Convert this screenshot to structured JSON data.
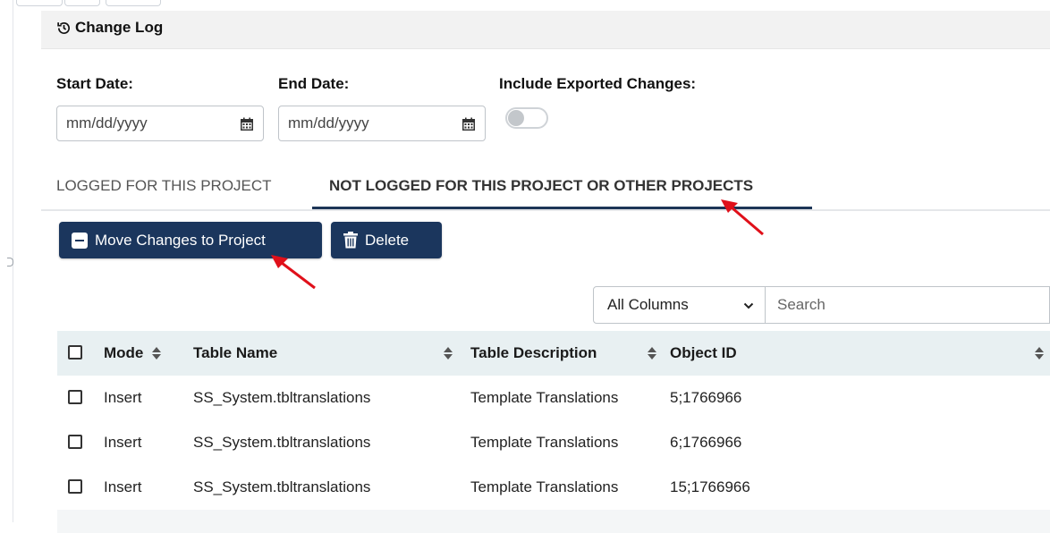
{
  "colors": {
    "primary": "#1b365d",
    "header_bg": "#e8f0f2",
    "annotation_arrow": "#e0101a"
  },
  "card": {
    "title": "Change Log",
    "icon": "history-icon"
  },
  "filters": {
    "start_label": "Start Date:",
    "end_label": "End Date:",
    "include_label": "Include Exported Changes:",
    "date_placeholder": "mm/dd/yyyy",
    "include_exported": false
  },
  "tabs": [
    {
      "label": "LOGGED FOR THIS PROJECT",
      "active": false
    },
    {
      "label": "NOT LOGGED FOR THIS PROJECT OR OTHER PROJECTS",
      "active": true
    }
  ],
  "actions": {
    "move_label": "Move Changes to Project",
    "delete_label": "Delete"
  },
  "search": {
    "column_select": "All Columns",
    "placeholder": "Search"
  },
  "table": {
    "headers": [
      "Mode",
      "Table Name",
      "Table Description",
      "Object ID"
    ],
    "rows": [
      {
        "mode": "Insert",
        "table_name": "SS_System.tbltranslations",
        "description": "Template Translations",
        "object_id": "5;1766966"
      },
      {
        "mode": "Insert",
        "table_name": "SS_System.tbltranslations",
        "description": "Template Translations",
        "object_id": "6;1766966"
      },
      {
        "mode": "Insert",
        "table_name": "SS_System.tbltranslations",
        "description": "Template Translations",
        "object_id": "15;1766966"
      }
    ]
  }
}
